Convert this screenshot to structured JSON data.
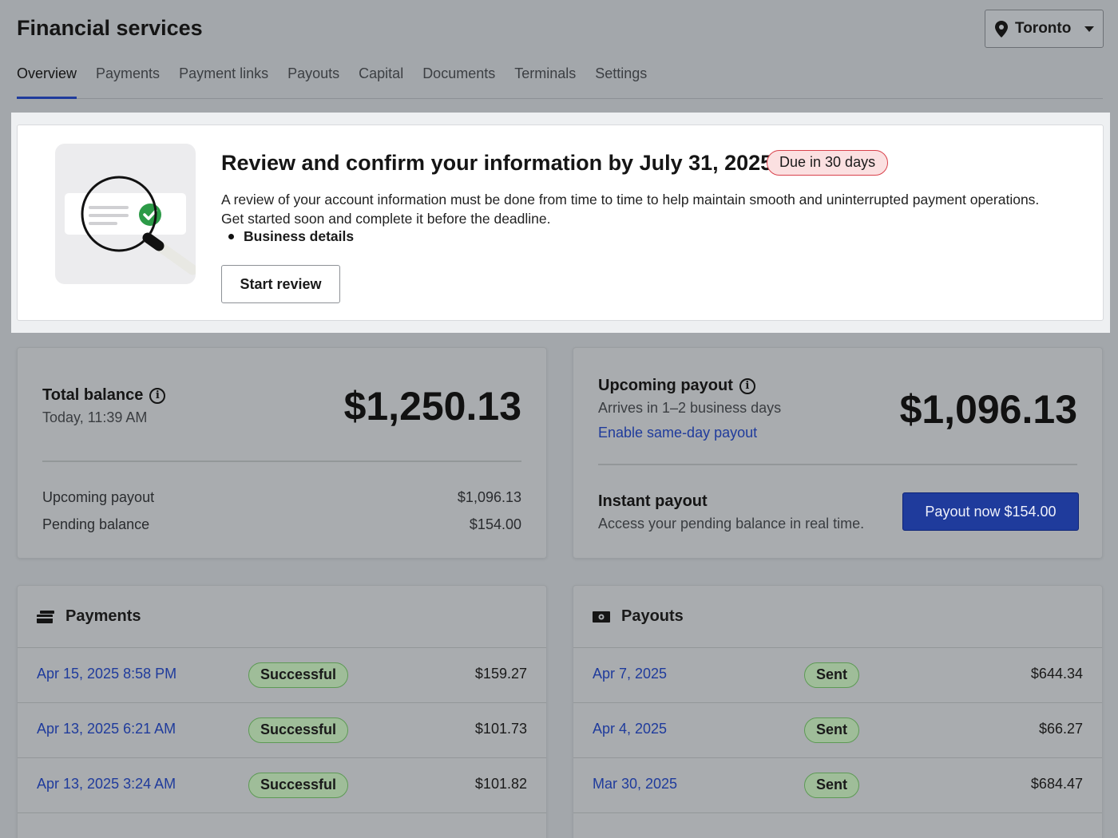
{
  "header": {
    "title": "Financial services",
    "location": "Toronto"
  },
  "tabs": [
    "Overview",
    "Payments",
    "Payment links",
    "Payouts",
    "Capital",
    "Documents",
    "Terminals",
    "Settings"
  ],
  "banner": {
    "title": "Review and confirm your information by July 31, 2025",
    "badge": "Due in 30 days",
    "description": "A review of your account information must be done from time to time to help maintain smooth and uninterrupted payment operations. Get started soon and complete it before the deadline.",
    "bullet": "Business details",
    "button": "Start review"
  },
  "balance": {
    "label": "Total balance",
    "timestamp": "Today, 11:39 AM",
    "amount": "$1,250.13",
    "rows": [
      {
        "label": "Upcoming payout",
        "value": "$1,096.13"
      },
      {
        "label": "Pending balance",
        "value": "$154.00"
      }
    ]
  },
  "payout": {
    "label": "Upcoming payout",
    "sub": "Arrives in 1–2 business days",
    "link": "Enable same-day payout",
    "amount": "$1,096.13",
    "instant_label": "Instant payout",
    "instant_sub": "Access your pending balance in real time.",
    "button": "Payout now $154.00"
  },
  "payments": {
    "title": "Payments",
    "rows": [
      {
        "date": "Apr 15, 2025 8:58 PM",
        "status": "Successful",
        "amount": "$159.27"
      },
      {
        "date": "Apr 13, 2025 6:21 AM",
        "status": "Successful",
        "amount": "$101.73"
      },
      {
        "date": "Apr 13, 2025 3:24 AM",
        "status": "Successful",
        "amount": "$101.82"
      }
    ]
  },
  "payouts": {
    "title": "Payouts",
    "rows": [
      {
        "date": "Apr 7, 2025",
        "status": "Sent",
        "amount": "$644.34"
      },
      {
        "date": "Apr 4, 2025",
        "status": "Sent",
        "amount": "$66.27"
      },
      {
        "date": "Mar 30, 2025",
        "status": "Sent",
        "amount": "$684.47"
      }
    ]
  }
}
